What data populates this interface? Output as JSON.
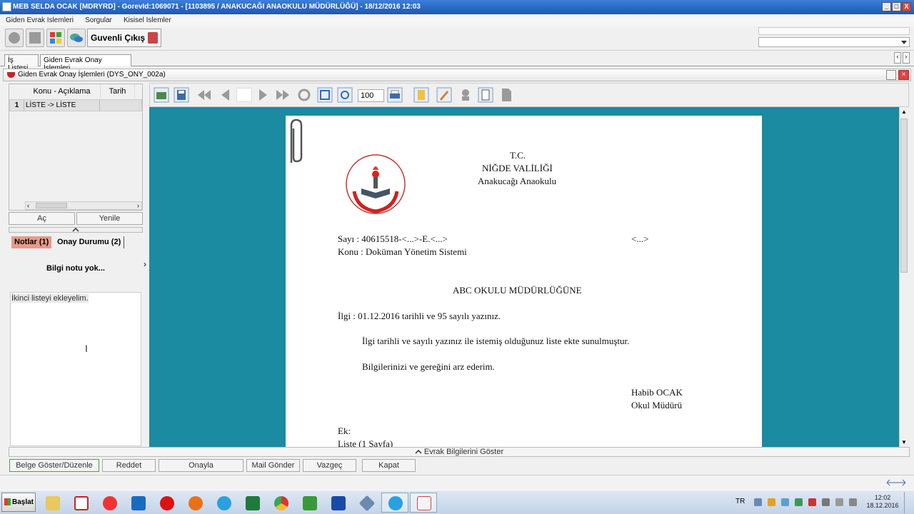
{
  "window": {
    "title": "MEB   SELDA OCAK  [MDRYRD] - GorevId:1069071 - [1103895 / ANAKUCAĞI ANAOKULU MÜDÜRLÜĞÜ] - 18/12/2016 12:03",
    "minimize": "_",
    "maximize": "□",
    "close": "X"
  },
  "menu": [
    "Giden Evrak Islemleri",
    "Sorgular",
    "Kisisel Islemler"
  ],
  "toolbar": {
    "logout_label": "Guvenli Çıkış"
  },
  "tabs": [
    "İş Listesi",
    "Giden Evrak Onay İşlemleri"
  ],
  "panel": {
    "title": "Giden Evrak Onay İşlemleri (DYS_ONY_002a)"
  },
  "grid": {
    "columns": [
      "Konu - Açıklama",
      "Tarih"
    ],
    "rows": [
      {
        "num": "1",
        "konu": "LİSTE -> LİSTE",
        "tarih": ""
      }
    ]
  },
  "left_buttons": {
    "open": "Aç",
    "refresh": "Yenile"
  },
  "note_tabs": {
    "notes": "Notlar (1)",
    "approval": "Onay Durumu (2)"
  },
  "notes": {
    "info": "Bilgi notu yok...",
    "text": "İkinci listeyi ekleyelim."
  },
  "viewer": {
    "zoom": "100"
  },
  "document": {
    "header": [
      "T.C.",
      "NİĞDE VALİLİĞİ",
      "Anakucağı Anaokulu"
    ],
    "sayi": "Sayı   : 40615518-<...>-E.<...>",
    "date_placeholder": "<...>",
    "konu": "Konu : Doküman Yönetim Sistemi",
    "recipient": "ABC OKULU MÜDÜRLÜĞÜNE",
    "ilgi": "İlgi : 01.12.2016 tarihli ve 95 sayılı yazınız.",
    "body1": "İlgi tarihli ve sayılı yazınız ile istemiş olduğunuz liste ekte sunulmuştur.",
    "body2": "Bilgilerinizi ve gereğini arz ederim.",
    "signer_name": "Habib OCAK",
    "signer_title": "Okul Müdürü",
    "ek_label": "Ek:",
    "ek_item": "Liste (1 Sayfa)"
  },
  "evrak_toggle": "Evrak Bilgilerini Göster",
  "bottom_buttons": [
    "Belge Göster/Düzenle",
    "Reddet",
    "Onayla",
    "Mail Gönder",
    "Vazgeç",
    "Kapat"
  ],
  "taskbar": {
    "start": "Başlat",
    "lang": "TR",
    "time": "12:02",
    "date": "18.12.2016"
  },
  "colors": {
    "viewer_bg": "#1a8ba0",
    "titlebar": "#2563c4"
  }
}
